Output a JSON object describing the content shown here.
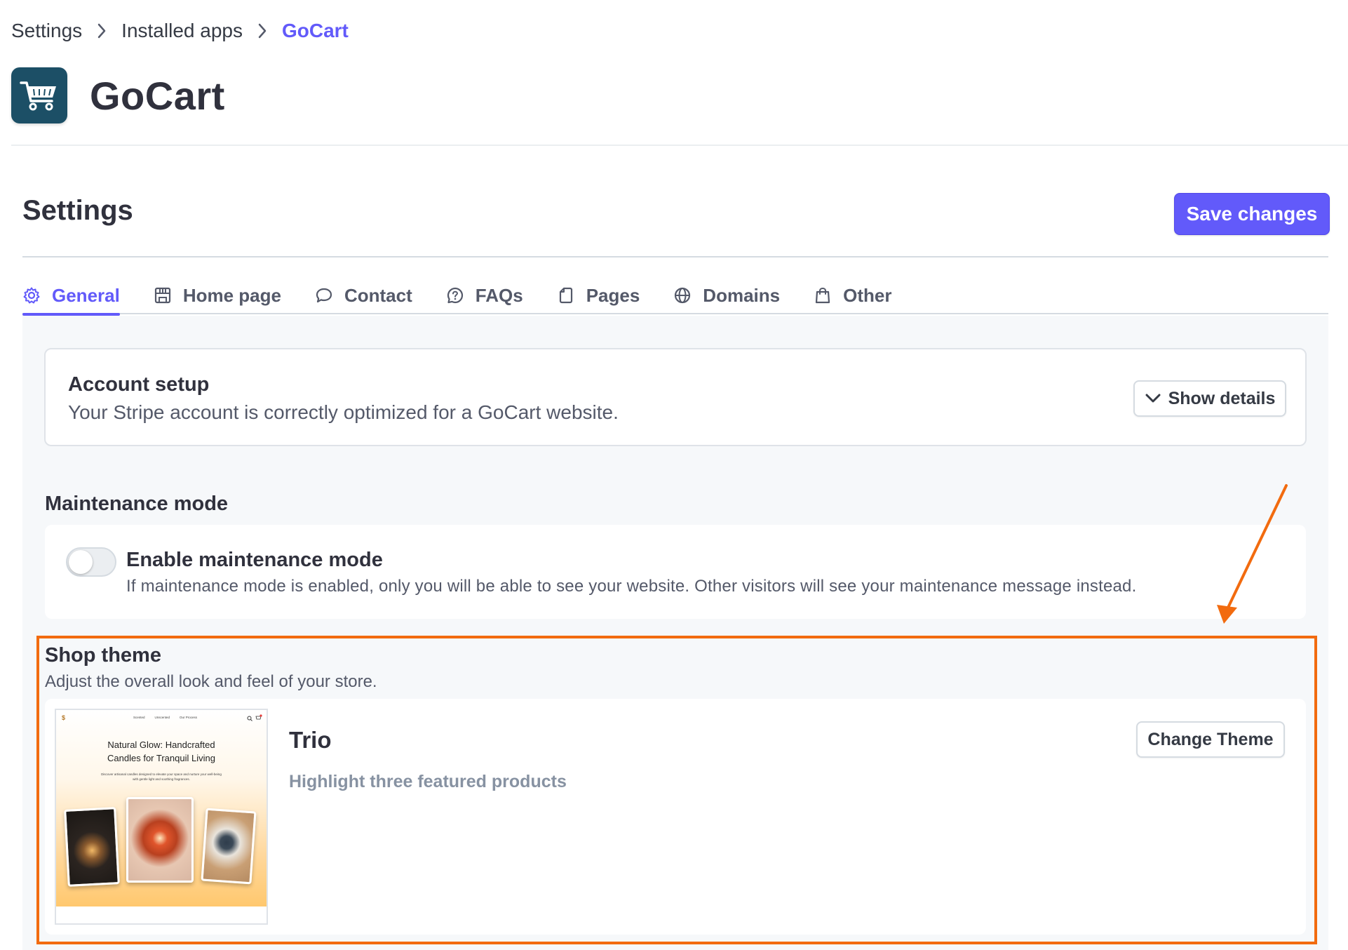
{
  "breadcrumb": {
    "items": [
      "Settings",
      "Installed apps"
    ],
    "current": "GoCart"
  },
  "app": {
    "name": "GoCart",
    "logo_icon": "shopping-cart-icon",
    "logo_color": "#1c4f66"
  },
  "settings": {
    "title": "Settings",
    "save_label": "Save changes"
  },
  "tabs": [
    {
      "label": "General",
      "icon": "gear-icon",
      "active": true
    },
    {
      "label": "Home page",
      "icon": "storefront-icon",
      "active": false
    },
    {
      "label": "Contact",
      "icon": "chat-bubble-icon",
      "active": false
    },
    {
      "label": "FAQs",
      "icon": "question-bubble-icon",
      "active": false
    },
    {
      "label": "Pages",
      "icon": "page-icon",
      "active": false
    },
    {
      "label": "Domains",
      "icon": "globe-icon",
      "active": false
    },
    {
      "label": "Other",
      "icon": "shopping-bag-icon",
      "active": false
    }
  ],
  "account_setup": {
    "title": "Account setup",
    "description": "Your Stripe account is correctly optimized for a GoCart website.",
    "button": "Show details"
  },
  "maintenance": {
    "heading": "Maintenance mode",
    "toggle_label": "Enable maintenance mode",
    "enabled": false,
    "description": "If maintenance mode is enabled, only you will be able to see your website. Other visitors will see your maintenance message instead."
  },
  "shop_theme": {
    "heading": "Shop theme",
    "description": "Adjust the overall look and feel of your store.",
    "theme_name": "Trio",
    "theme_tagline": "Highlight three featured products",
    "button": "Change Theme",
    "preview": {
      "headline_line1": "Natural Glow: Handcrafted",
      "headline_line2": "Candles for Tranquil Living",
      "subtext": "Discover artisanal candles designed to elevate your space and nurture your well-being with gentle light and soothing fragrances.",
      "nav_links": [
        "Scented",
        "Unscented",
        "Our Process"
      ]
    }
  },
  "colors": {
    "accent": "#625afa",
    "annotation": "#f26b0f",
    "muted_text": "#8792a2"
  }
}
